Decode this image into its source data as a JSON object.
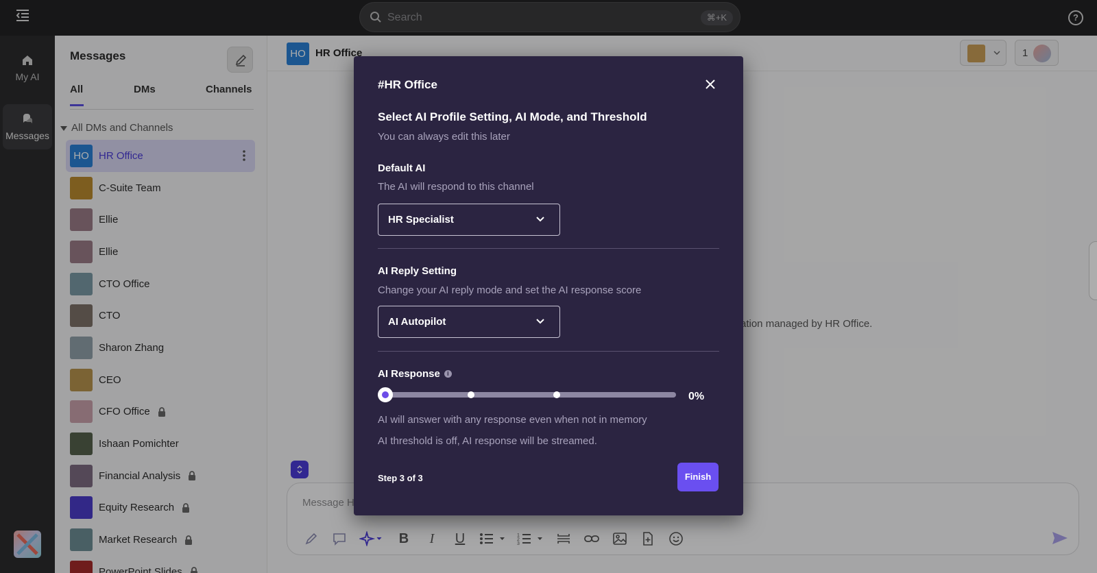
{
  "topbar": {
    "search_placeholder": "Search",
    "search_shortcut": "⌘+K",
    "help_label": "?"
  },
  "rail": {
    "items": [
      {
        "label": "My AI",
        "icon": "home-icon"
      },
      {
        "label": "Messages",
        "icon": "chat-bubbles-icon"
      }
    ]
  },
  "sidebar": {
    "title": "Messages",
    "tabs": [
      "All",
      "DMs",
      "Channels"
    ],
    "group_title": "All DMs and Channels",
    "channels": [
      {
        "name": "HR Office",
        "initials": "HO",
        "color": "#2a7fd4",
        "locked": false,
        "active": true
      },
      {
        "name": "C-Suite Team",
        "initials": "",
        "color": "#b8892f",
        "locked": false
      },
      {
        "name": "Ellie",
        "initials": "",
        "color": "#9a7b86",
        "locked": false
      },
      {
        "name": "Ellie",
        "initials": "",
        "color": "#9a7b86",
        "locked": false
      },
      {
        "name": "CTO Office",
        "initials": "",
        "color": "#7a98a4",
        "locked": false
      },
      {
        "name": "CTO",
        "initials": "",
        "color": "#7c7068",
        "locked": false
      },
      {
        "name": "Sharon Zhang",
        "initials": "",
        "color": "#8fa0a8",
        "locked": false
      },
      {
        "name": "CEO",
        "initials": "",
        "color": "#b5924d",
        "locked": false
      },
      {
        "name": "CFO Office",
        "initials": "",
        "color": "#c8a0aa",
        "locked": true
      },
      {
        "name": "Ishaan Pomichter",
        "initials": "",
        "color": "#54614c",
        "locked": false
      },
      {
        "name": "Financial Analysis",
        "initials": "",
        "color": "#7c6a80",
        "locked": true
      },
      {
        "name": "Equity Research",
        "initials": "",
        "color": "#4a3bc8",
        "locked": true
      },
      {
        "name": "Market Research",
        "initials": "",
        "color": "#6c8c94",
        "locked": true
      },
      {
        "name": "PowerPoint Slides",
        "initials": "",
        "color": "#a42a2a",
        "locked": true
      }
    ]
  },
  "chat": {
    "title": "HR Office",
    "avatar": "HO",
    "members_count": "1",
    "body_text": "ation managed by HR Office.",
    "composer_placeholder": "Message H"
  },
  "modal": {
    "title": "#HR Office",
    "heading": "Select AI Profile Setting, AI Mode, and Threshold",
    "subheading": "You can always edit this later",
    "default_ai": {
      "label": "Default AI",
      "help": "The AI will respond to this channel",
      "value": "HR Specialist"
    },
    "reply_setting": {
      "label": "AI Reply Setting",
      "help": "Change your AI reply mode and set the AI response score",
      "value": "AI Autopilot"
    },
    "response": {
      "label": "AI Response",
      "value_text": "0%",
      "value": 0,
      "line1": "AI will answer with any response even when not in memory",
      "line2": "AI threshold is off, AI response will be streamed."
    },
    "step": "Step 3 of 3",
    "finish_label": "Finish"
  },
  "colors": {
    "accent": "#6a4ff0",
    "modal_bg": "#2b2441"
  }
}
